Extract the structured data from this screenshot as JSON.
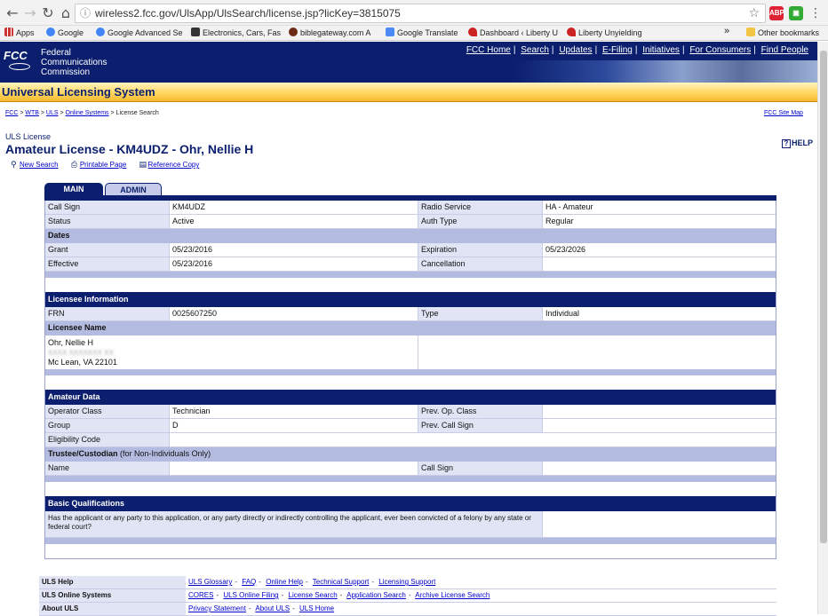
{
  "browser": {
    "url": "wireless2.fcc.gov/UlsApp/UlsSearch/license.jsp?licKey=3815075",
    "bookmarks": [
      "Apps",
      "Google",
      "Google Advanced Se",
      "Electronics, Cars, Fas",
      "biblegateway.com A",
      "Google Translate",
      "Dashboard ‹ Liberty U",
      "Liberty Unyielding"
    ],
    "overflow": "»",
    "other_bookmarks": "Other bookmarks",
    "ext_abp": "ABP"
  },
  "header": {
    "logo": "FCC",
    "agency_line1": "Federal",
    "agency_line2": "Communications",
    "agency_line3": "Commission",
    "links": [
      "FCC Home",
      "Search",
      "Updates",
      "E-Filing",
      "Initiatives",
      "For Consumers",
      "Find People"
    ],
    "banner": "Universal Licensing System"
  },
  "breadcrumb": {
    "items": [
      "FCC",
      "WTB",
      "ULS",
      "Online Systems"
    ],
    "current": "License Search",
    "sitemap": "FCC Site Map"
  },
  "title": {
    "label": "ULS License",
    "heading": "Amateur License - KM4UDZ - Ohr, Nellie H",
    "help": "HELP"
  },
  "actions": {
    "new_search": "New Search",
    "printable": "Printable Page",
    "reference": "Reference Copy"
  },
  "tabs": {
    "main": "MAIN",
    "admin": "ADMIN"
  },
  "license": {
    "call_sign_label": "Call Sign",
    "call_sign": "KM4UDZ",
    "radio_service_label": "Radio Service",
    "radio_service": "HA - Amateur",
    "status_label": "Status",
    "status": "Active",
    "auth_type_label": "Auth Type",
    "auth_type": "Regular",
    "dates_label": "Dates",
    "grant_label": "Grant",
    "grant": "05/23/2016",
    "expiration_label": "Expiration",
    "expiration": "05/23/2026",
    "effective_label": "Effective",
    "effective": "05/23/2016",
    "cancellation_label": "Cancellation",
    "cancellation": ""
  },
  "licensee": {
    "section": "Licensee Information",
    "frn_label": "FRN",
    "frn": "0025607250",
    "type_label": "Type",
    "type": "Individual",
    "name_label": "Licensee Name",
    "name": "Ohr, Nellie H",
    "street": "XXXX XXXXXXX XX",
    "city": "Mc Lean, VA 22101"
  },
  "amateur": {
    "section": "Amateur Data",
    "operator_class_label": "Operator Class",
    "operator_class": "Technician",
    "prev_op_class_label": "Prev. Op. Class",
    "prev_op_class": "",
    "group_label": "Group",
    "group": "D",
    "prev_call_sign_label": "Prev. Call Sign",
    "prev_call_sign": "",
    "eligibility_label": "Eligibility Code",
    "eligibility": "",
    "trustee_label": "Trustee/Custodian",
    "trustee_note": "(for Non-Individuals Only)",
    "name_label": "Name",
    "name": "",
    "call_sign_label": "Call Sign",
    "call_sign": ""
  },
  "qualifications": {
    "section": "Basic Qualifications",
    "question": "Has the applicant or any party to this application, or any party directly or indirectly controlling the applicant, ever been convicted of a felony by any state or federal court?",
    "answer": ""
  },
  "footer": {
    "help_label": "ULS Help",
    "help_links": [
      "ULS Glossary",
      "FAQ",
      "Online Help",
      "Technical Support",
      "Licensing Support"
    ],
    "systems_label": "ULS Online Systems",
    "systems_links": [
      "CORES",
      "ULS Online Filing",
      "License Search",
      "Application Search",
      "Archive License Search"
    ],
    "about_label": "About ULS",
    "about_links": [
      "Privacy Statement",
      "About ULS",
      "ULS Home"
    ]
  }
}
